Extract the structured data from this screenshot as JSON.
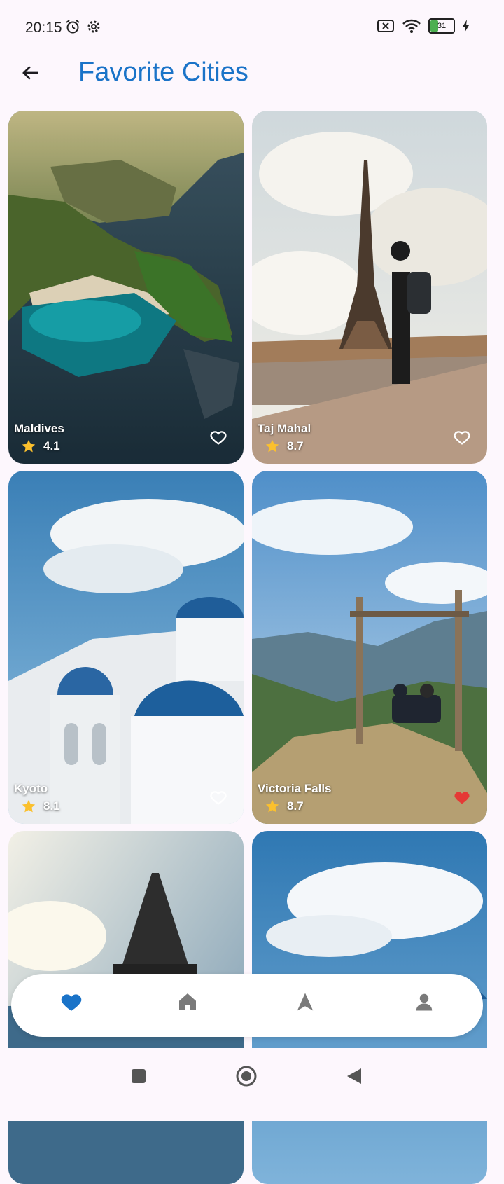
{
  "status_bar": {
    "time": "20:15",
    "battery_level": "31",
    "icons_left": [
      "alarm-icon",
      "settings-icon"
    ],
    "icons_right": [
      "no-sim-icon",
      "wifi-icon",
      "battery-icon",
      "charging-icon"
    ]
  },
  "app_bar": {
    "title": "Favorite Cities",
    "back_icon": "arrow-back-icon"
  },
  "cities": [
    {
      "name": "Maldives",
      "rating": "4.1",
      "favorite": false
    },
    {
      "name": "Taj Mahal",
      "rating": "8.7",
      "favorite": false
    },
    {
      "name": "Kyoto",
      "rating": "8.1",
      "favorite": false
    },
    {
      "name": "Victoria Falls",
      "rating": "8.7",
      "favorite": true
    },
    {
      "name": "",
      "rating": "",
      "favorite": false
    },
    {
      "name": "",
      "rating": "",
      "favorite": false
    }
  ],
  "bottom_nav": {
    "items": [
      "favorites-icon",
      "home-icon",
      "navigate-icon",
      "profile-icon"
    ],
    "active_index": 0
  },
  "colors": {
    "accent": "#1a73c8",
    "favorite_active": "#e53935",
    "star": "#fbc02d",
    "nav_active": "#1a73c8",
    "nav_inactive": "#7a7a7a"
  }
}
